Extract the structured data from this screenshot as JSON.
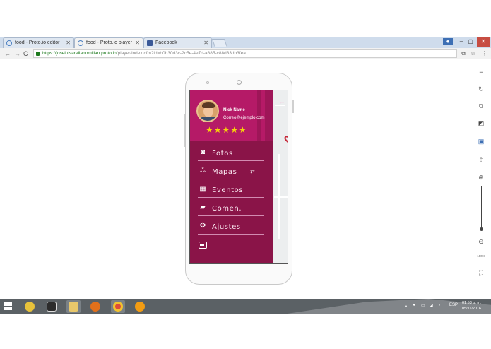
{
  "browser": {
    "tabs": [
      {
        "label": "food - Proto.io editor"
      },
      {
        "label": "food - Proto.io player"
      },
      {
        "label": "Facebook"
      }
    ],
    "url_host": "https://joseluisarellanomillan.proto.io",
    "url_path": "/player/index.cfm?id=b0b30d3c-2c5e-4e7d-a885-c88d33db3fea",
    "window_controls": {
      "min": "–",
      "max": "▢",
      "close": "✕"
    }
  },
  "drawer": {
    "user_name": "Nick Name",
    "user_email": "Correo@ejemplo.com",
    "rating_stars": "★★★★★",
    "rating_value": 5,
    "back_arrow": "←",
    "items": [
      {
        "label": "Fotos",
        "icon": "camera-icon",
        "glyph": "📷"
      },
      {
        "label": "Mapas",
        "icon": "route-icon",
        "glyph": "ᨖ",
        "extra": "⇄"
      },
      {
        "label": "Eventos",
        "icon": "calendar-icon",
        "glyph": "▦"
      },
      {
        "label": "Comen.",
        "icon": "comments-icon",
        "glyph": "💬"
      },
      {
        "label": "Ajustes",
        "icon": "gear-icon",
        "glyph": "⚙"
      }
    ]
  },
  "right_panel": {
    "zoom_label": "100%"
  },
  "taskbar": {
    "language": "ESP",
    "time": "01:53 p. m.",
    "date": "05/11/2016"
  },
  "colors": {
    "drawer_bg": "#8a1448",
    "header_bg": "#b51a67",
    "star": "#f5d20a",
    "accent_pin": "#c62b3c"
  }
}
